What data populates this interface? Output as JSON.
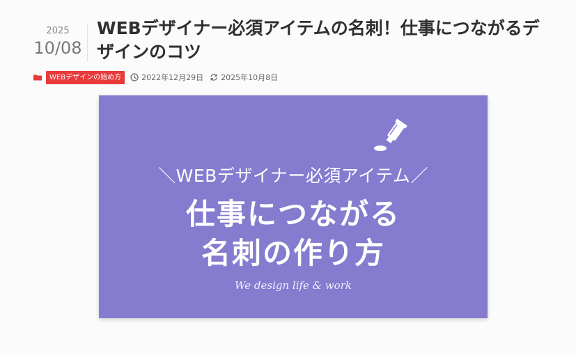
{
  "post": {
    "date": {
      "year": "2025",
      "month_day": "10/08"
    },
    "title": "WEBデザイナー必須アイテムの名刺！仕事につながるデザインのコツ",
    "category": "WEBデザインの始め方",
    "published": "2022年12月29日",
    "updated": "2025年10月8日"
  },
  "hero": {
    "subtitle": "＼WEBデザイナー必須アイテム／",
    "headline_line1": "仕事につながる",
    "headline_line2": "名刺の作り方",
    "tagline": "We design life & work",
    "background_color": "#857bcf"
  },
  "icons": {
    "category": "folder-icon",
    "published": "clock-icon",
    "updated": "refresh-icon",
    "hero": "tube-icon"
  },
  "colors": {
    "category_badge": "#e83a3a",
    "title": "#2f2f2f"
  }
}
